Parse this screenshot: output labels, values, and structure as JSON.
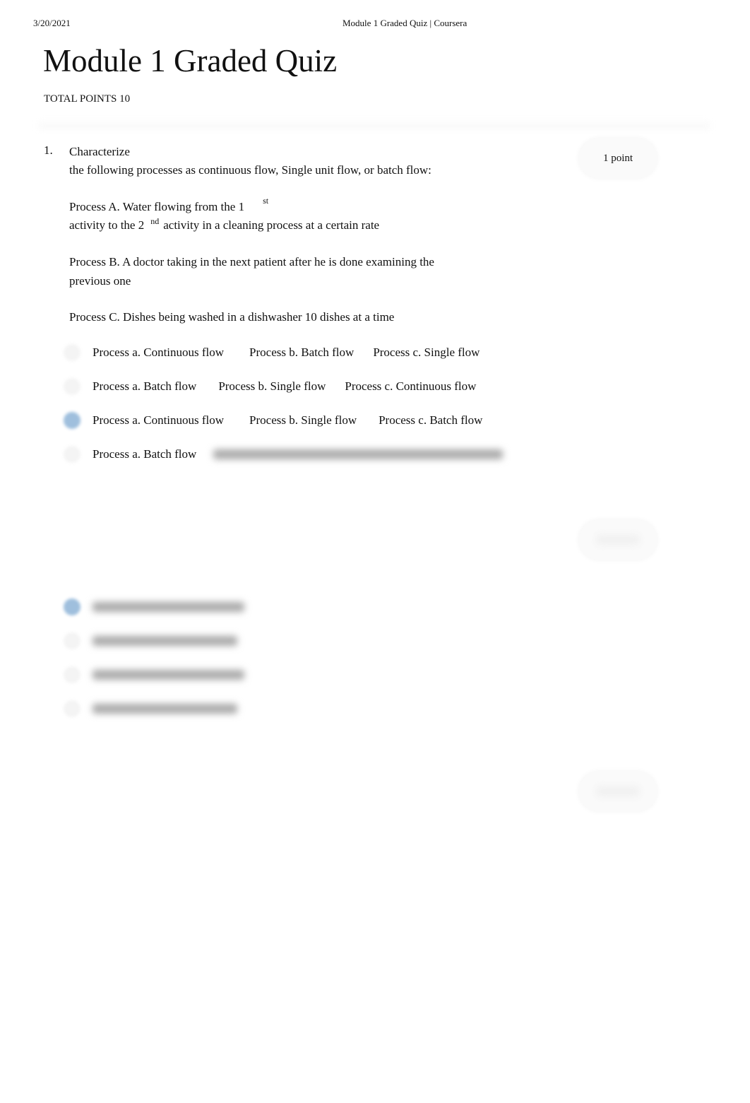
{
  "print_header": {
    "date": "3/20/2021",
    "page_title": "Module 1 Graded Quiz | Coursera"
  },
  "title": "Module 1 Graded Quiz",
  "total_points": "TOTAL POINTS 10",
  "question1": {
    "number": "1.",
    "points": "1 point",
    "line1": "Characterize",
    "line2": "the following processes as continuous flow, Single unit flow, or batch flow:",
    "processA_1": "Process A. Water flowing from the 1",
    "processA_sup1": "st",
    "processA_2": "activity to the 2",
    "processA_sup2": "nd",
    "processA_3": "activity in a cleaning process at a certain rate",
    "processB_1": "Process B. A doctor taking in the next patient after he is done examining the",
    "processB_2": "previous one",
    "processC": "Process C. Dishes being washed in a dishwasher 10 dishes at a time",
    "options": [
      {
        "a": "Process a. Continuous flow",
        "b": "Process b. Batch flow",
        "c": "Process c. Single flow",
        "selected": false
      },
      {
        "a": "Process a. Batch flow",
        "b": "Process b. Single flow",
        "c": "Process c. Continuous flow",
        "selected": false
      },
      {
        "a": "Process a. Continuous flow",
        "b": "Process b. Single flow",
        "c": "Process c. Batch flow",
        "selected": true
      },
      {
        "a": "Process a. Batch flow",
        "selected": false
      }
    ]
  },
  "question2": {
    "selected_index": 0
  },
  "colors": {
    "selected_radio": "#9fbfdd"
  }
}
